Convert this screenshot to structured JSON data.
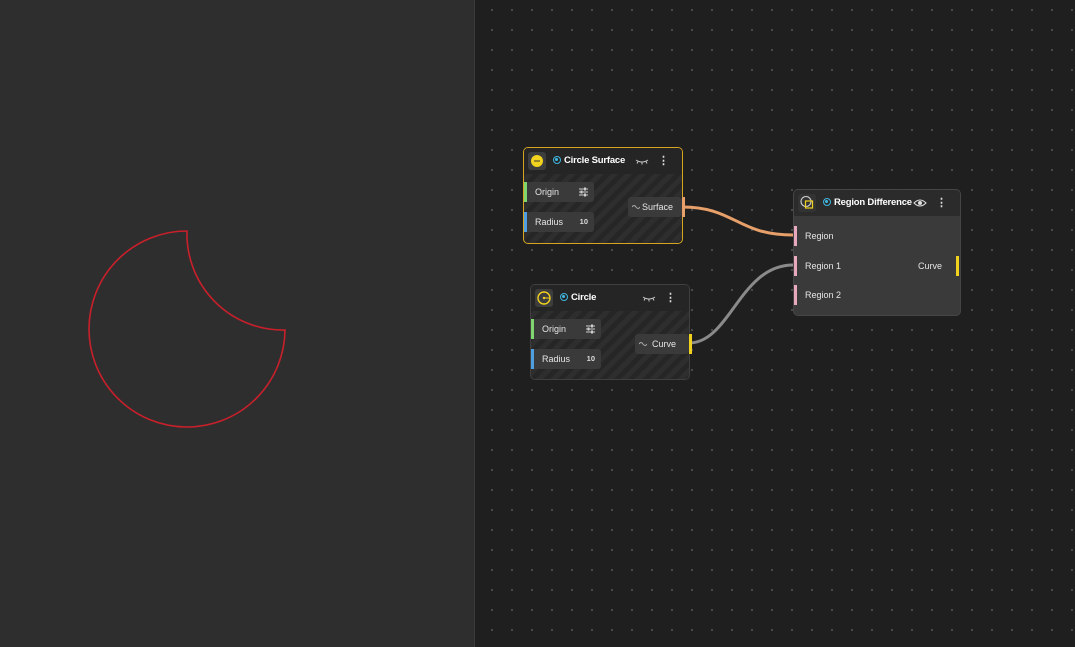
{
  "viewport": {
    "shape_color": "#c8202b",
    "background": "#2e2e2e"
  },
  "colors": {
    "surface_wire": "#e8a06a",
    "curve_wire": "#8a8a8a",
    "accent_yellow": "#f1d21e",
    "selected_border": "#d6a521",
    "origin_port": "#7fd66f",
    "radius_port": "#4f9fe0",
    "region_port": "#e9a9bd",
    "info_badge": "#3fb6df"
  },
  "nodes": {
    "circle_surface": {
      "title": "Circle Surface",
      "icon": "circle-surface-icon",
      "inputs": {
        "origin_label": "Origin",
        "radius_label": "Radius",
        "radius_value": "10"
      },
      "output_label": "Surface"
    },
    "circle": {
      "title": "Circle",
      "icon": "circle-curve-icon",
      "inputs": {
        "origin_label": "Origin",
        "radius_label": "Radius",
        "radius_value": "10"
      },
      "output_label": "Curve"
    },
    "region_difference": {
      "title": "Region Difference",
      "icon": "region-difference-icon",
      "inputs": {
        "region_label": "Region",
        "region1_label": "Region 1",
        "region2_label": "Region 2"
      },
      "output_label": "Curve"
    }
  }
}
